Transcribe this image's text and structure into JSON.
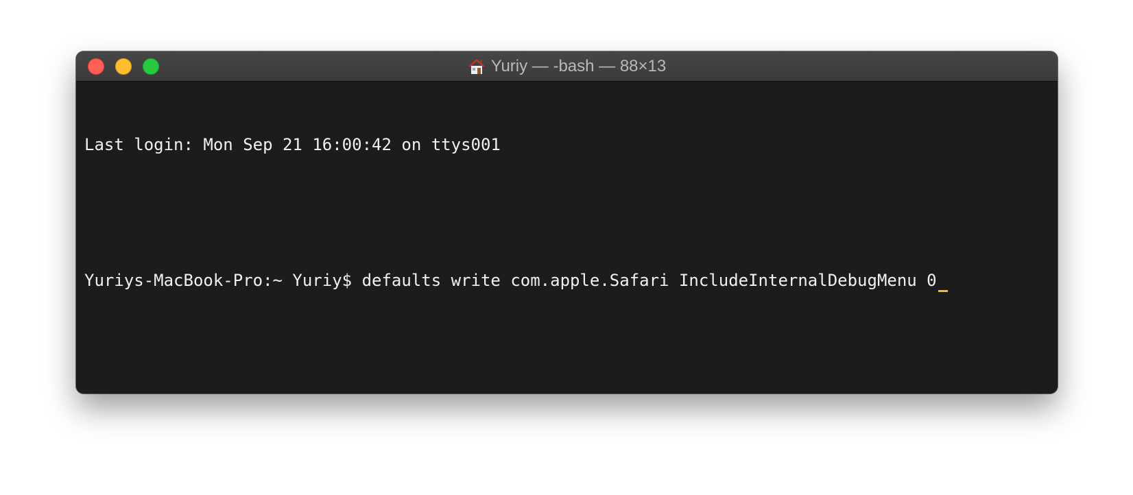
{
  "window": {
    "title": "Yuriy — -bash — 88×13",
    "title_icon": "home-icon"
  },
  "terminal": {
    "lines": [
      "Last login: Mon Sep 21 16:00:42 on ttys001",
      "",
      "Yuriys-MacBook-Pro:~ Yuriy$ defaults write com.apple.Safari IncludeInternalDebugMenu 0"
    ],
    "cursor_color": "#f5b72b"
  },
  "colors": {
    "background": "#1c1c1c",
    "text": "#f0f0f0",
    "close": "#ff5f57",
    "minimize": "#febc2e",
    "zoom": "#28c840"
  }
}
